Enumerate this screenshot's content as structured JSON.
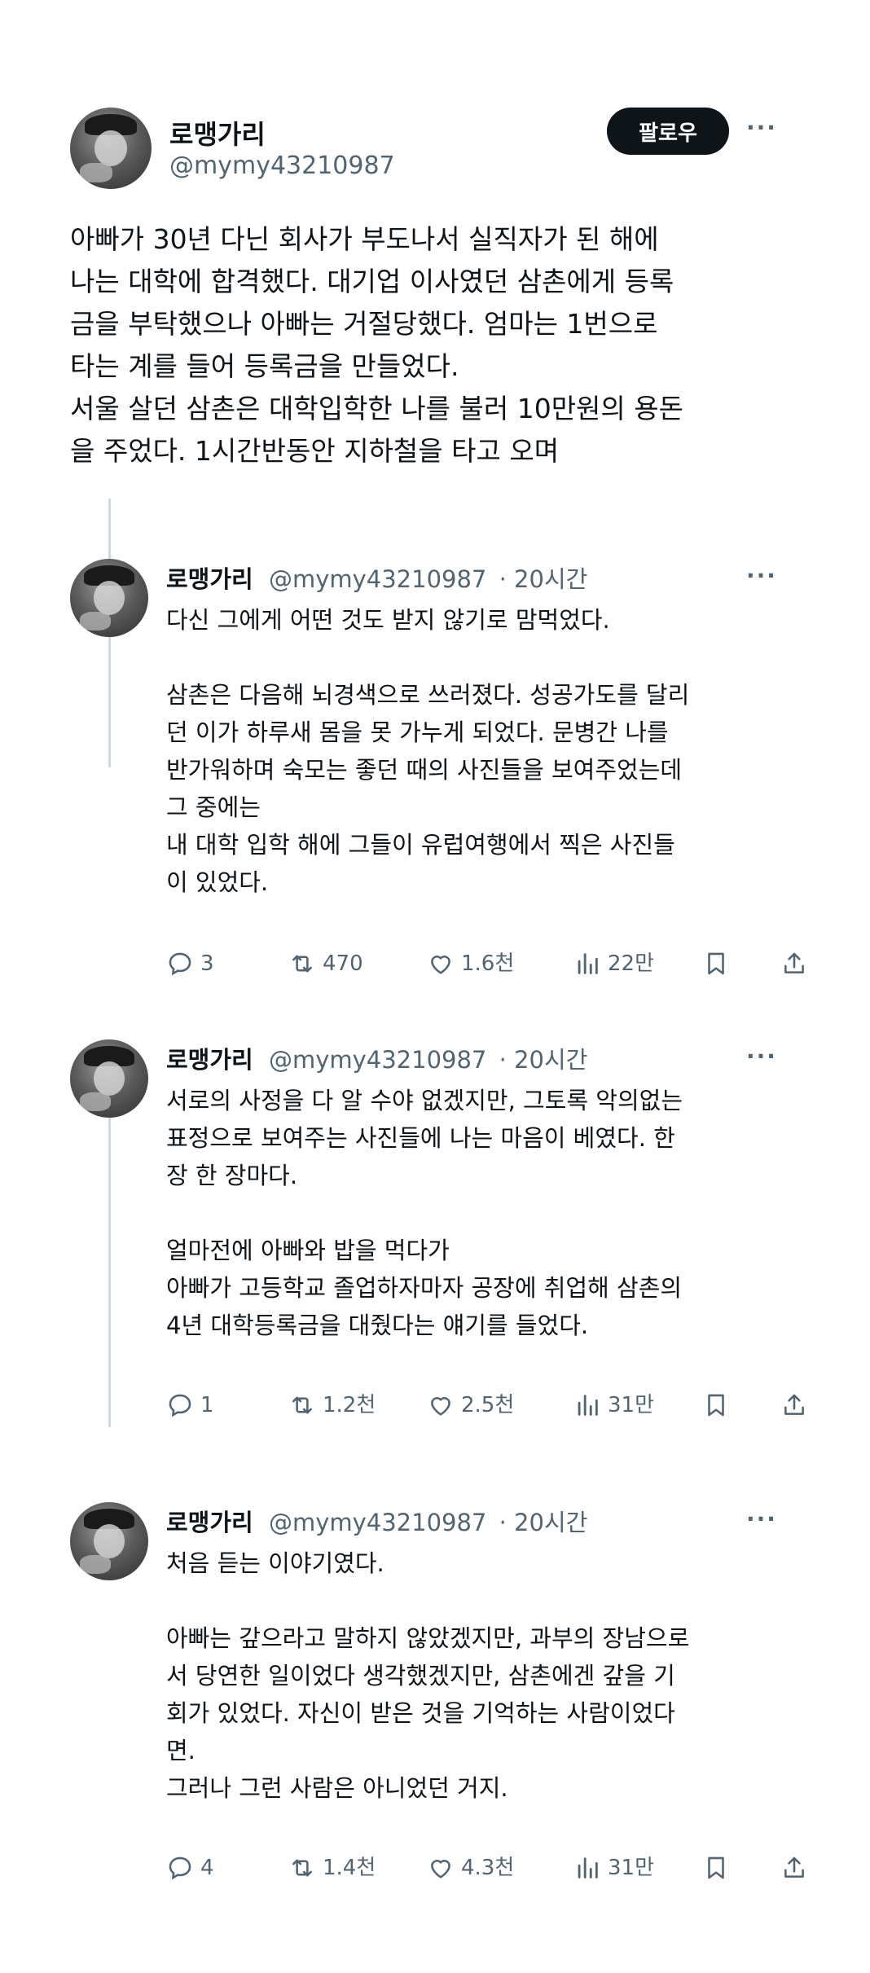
{
  "main_tweet": {
    "name": "로맹가리",
    "handle": "@mymy43210987",
    "follow_label": "팔로우",
    "more": "···",
    "text": "아빠가 30년 다닌 회사가 부도나서 실직자가 된 해에\n나는 대학에 합격했다. 대기업 이사였던 삼촌에게 등록\n금을 부탁했으나 아빠는 거절당했다. 엄마는 1번으로\n타는 계를 들어 등록금을 만들었다.\n서울 살던 삼촌은 대학입학한 나를 불러 10만원의 용돈\n을 주었다. 1시간반동안 지하철을 타고 오며"
  },
  "replies": [
    {
      "name": "로맹가리",
      "handle": "@mymy43210987",
      "time": "· 20시간",
      "more": "···",
      "text": "다신 그에게 어떤 것도 받지 않기로 맘먹었다.\n\n삼촌은 다음해 뇌경색으로 쓰러졌다. 성공가도를 달리\n던 이가 하루새 몸을 못 가누게 되었다. 문병간 나를\n반가워하며 숙모는 좋던 때의 사진들을 보여주었는데\n그 중에는\n내 대학 입학 해에 그들이 유럽여행에서 찍은 사진들\n이 있었다.",
      "replies": "3",
      "retweets": "470",
      "likes": "1.6천",
      "views": "22만"
    },
    {
      "name": "로맹가리",
      "handle": "@mymy43210987",
      "time": "· 20시간",
      "more": "···",
      "text": "서로의 사정을 다 알 수야 없겠지만, 그토록 악의없는\n표정으로 보여주는 사진들에 나는 마음이 베였다. 한\n장 한 장마다.\n\n얼마전에 아빠와 밥을 먹다가\n아빠가 고등학교 졸업하자마자 공장에 취업해 삼촌의\n4년 대학등록금을 대줬다는 얘기를 들었다.",
      "replies": "1",
      "retweets": "1.2천",
      "likes": "2.5천",
      "views": "31만"
    },
    {
      "name": "로맹가리",
      "handle": "@mymy43210987",
      "time": "· 20시간",
      "more": "···",
      "text": "처음 듣는 이야기였다.\n\n아빠는 갚으라고 말하지 않았겠지만, 과부의 장남으로\n서 당연한 일이었다 생각했겠지만, 삼촌에겐 갚을 기\n회가 있었다. 자신이 받은 것을 기억하는 사람이었다\n면.\n그러나 그런 사람은 아니었던 거지.",
      "replies": "4",
      "retweets": "1.4천",
      "likes": "4.3천",
      "views": "31만"
    }
  ]
}
